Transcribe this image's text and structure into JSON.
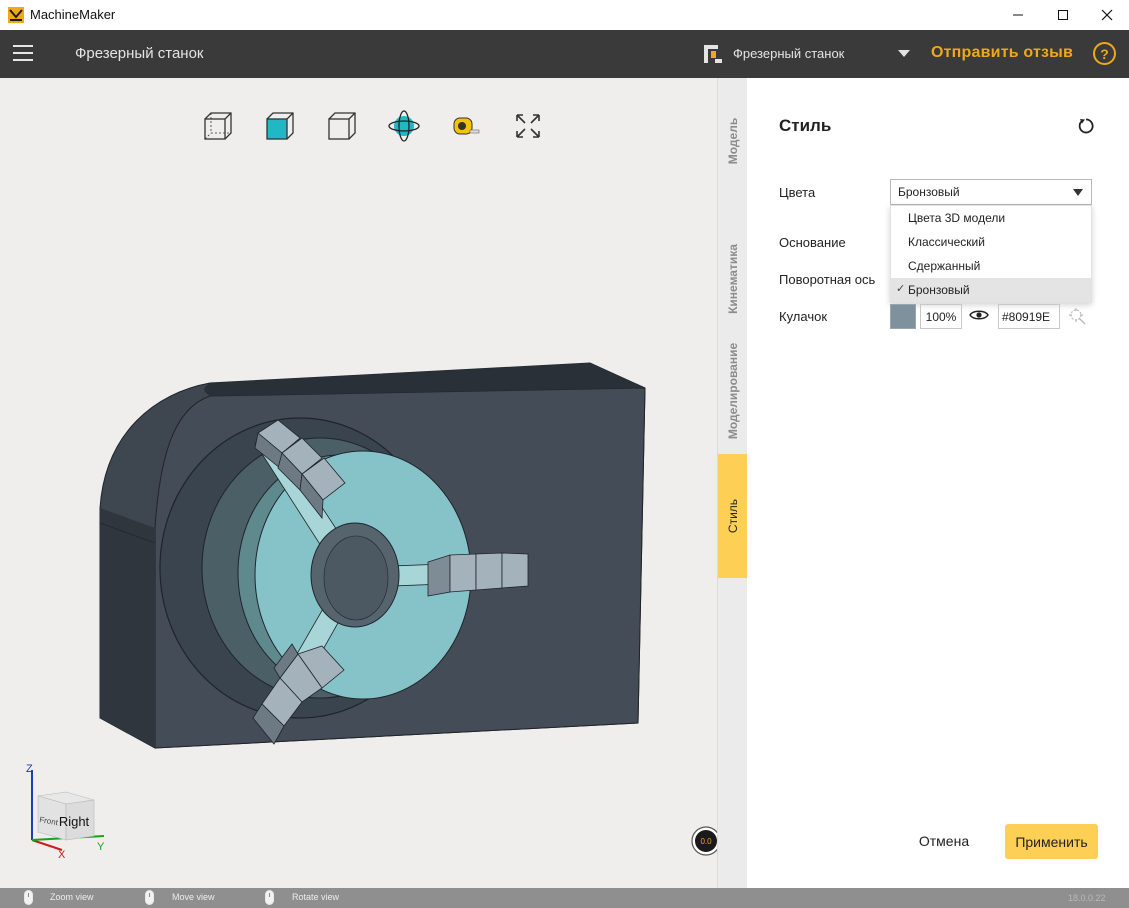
{
  "window": {
    "title": "MachineMaker",
    "min_icon": "minimize-icon",
    "max_icon": "maximize-icon",
    "close_icon": "close-icon"
  },
  "header": {
    "title": "Фрезерный станок",
    "machine_name": "Фрезерный станок",
    "feedback_label": "Отправить отзыв",
    "help_label": "?",
    "accent_color": "#f0a818"
  },
  "toolbar": {
    "icons": [
      "view-cube-wireframe-icon",
      "view-cube-solid-icon",
      "view-cube-outline-icon",
      "orbit-icon",
      "tape-measure-icon",
      "fit-view-icon"
    ]
  },
  "navcube": {
    "face_label": "Right",
    "side_label": "Front",
    "x_label": "X",
    "y_label": "Y",
    "z_label": "Z"
  },
  "speed": {
    "value": "0.0"
  },
  "tabs": [
    {
      "label": "Модель",
      "active": false
    },
    {
      "label": "Кинематика",
      "active": false
    },
    {
      "label": "Моделирование",
      "active": false
    },
    {
      "label": "Стиль",
      "active": true
    }
  ],
  "panel": {
    "title": "Стиль",
    "colors_label": "Цвета",
    "colors_value": "Бронзовый",
    "colors_options": [
      {
        "label": "Цвета 3D модели",
        "selected": false
      },
      {
        "label": "Классический",
        "selected": false
      },
      {
        "label": "Сдержанный",
        "selected": false
      },
      {
        "label": "Бронзовый",
        "selected": true
      }
    ],
    "base_label": "Основание",
    "rotary_label": "Поворотная ось",
    "jaw_label": "Кулачок",
    "jaw_opacity": "100%",
    "jaw_hex": "#80919E",
    "jaw_color": "#80919e",
    "check_mark": "✓",
    "cancel_label": "Отмена",
    "apply_label": "Применить"
  },
  "statusbar": {
    "zoom": "Zoom view",
    "move": "Move view",
    "rotate": "Rotate view",
    "version": "18.0.0.22"
  }
}
